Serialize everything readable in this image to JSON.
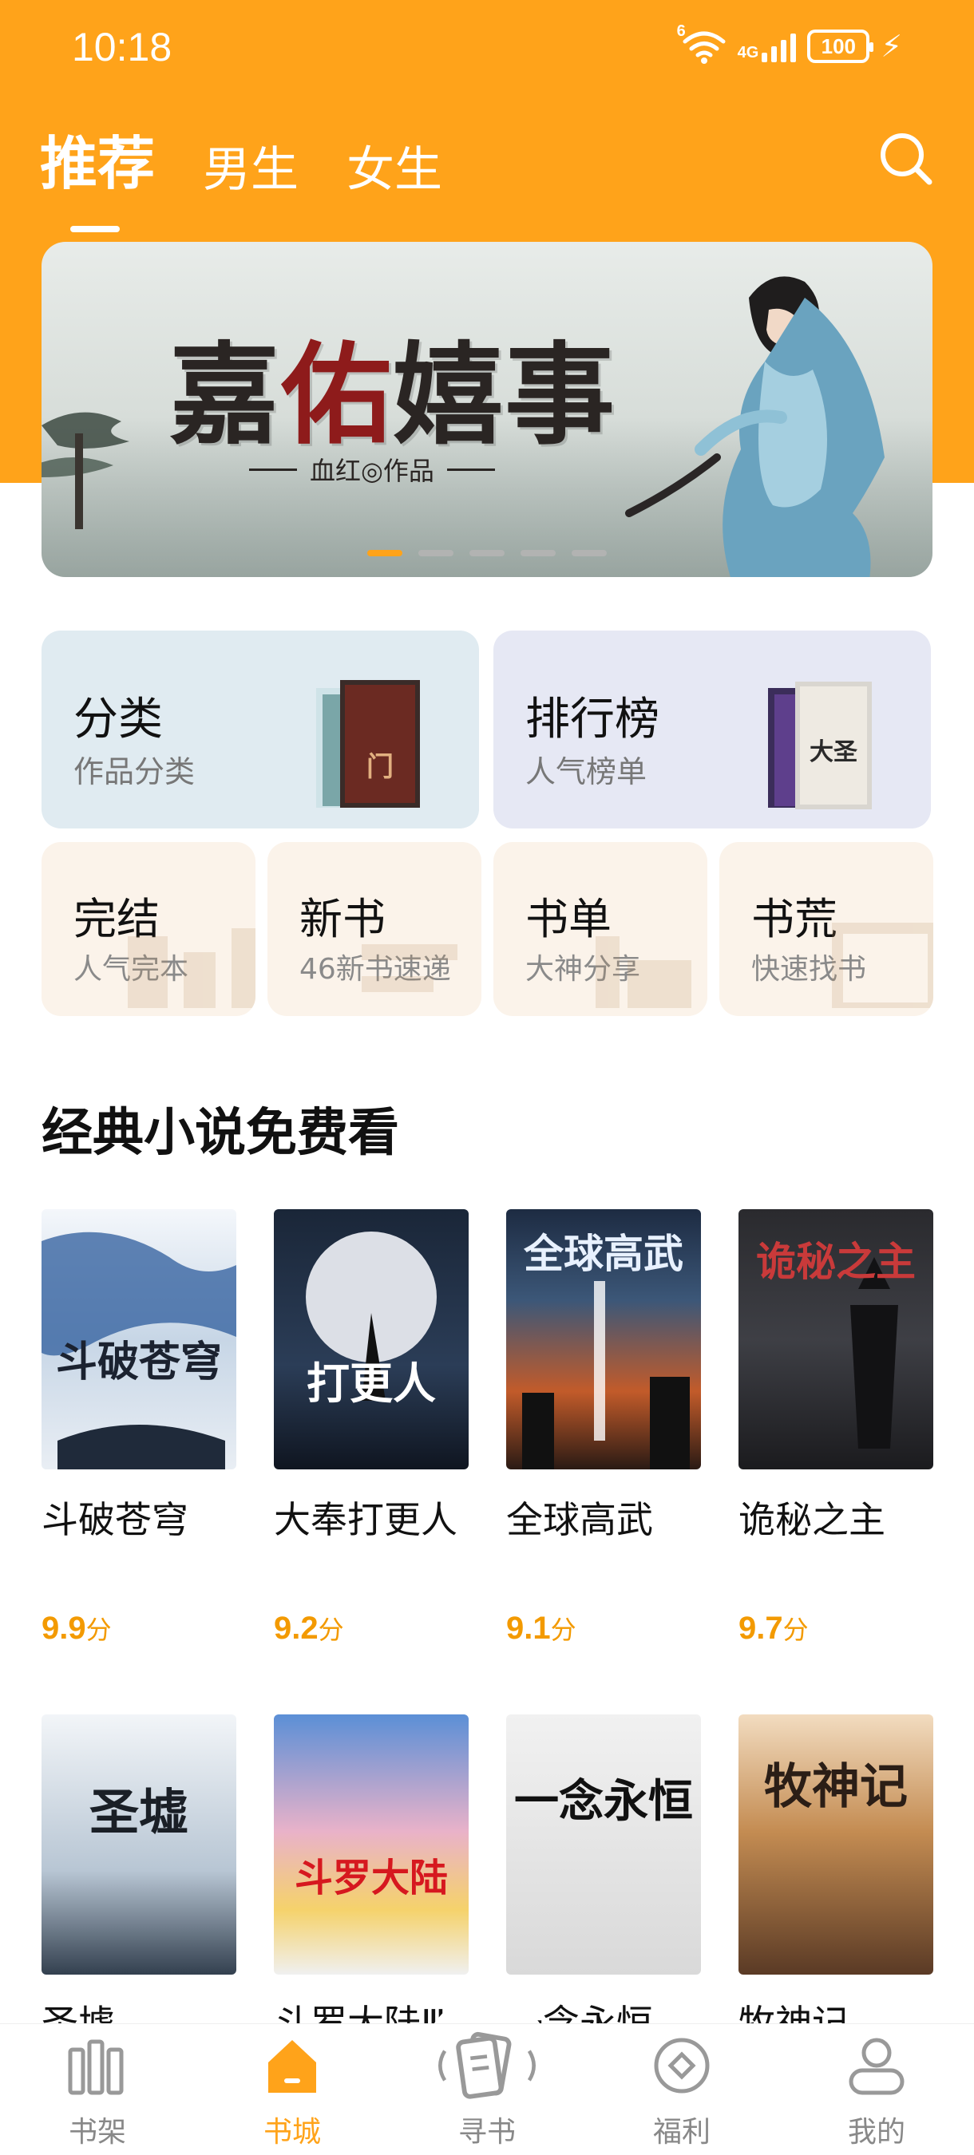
{
  "status_bar": {
    "time": "10:18",
    "wifi_tag": "6",
    "network": "4G",
    "battery": "100"
  },
  "top_tabs": [
    {
      "label": "推荐",
      "active": true
    },
    {
      "label": "男生",
      "active": false
    },
    {
      "label": "女生",
      "active": false
    }
  ],
  "banner": {
    "title_part1": "嘉",
    "title_part2": "佑",
    "title_part3": "嬉事",
    "subtitle": "血红◎作品",
    "page_count": 5,
    "active_index": 0
  },
  "entries_big": [
    {
      "title": "分类",
      "subtitle": "作品分类",
      "bg": "#e0ebf1"
    },
    {
      "title": "排行榜",
      "subtitle": "人气榜单",
      "bg": "#e6e8f4"
    }
  ],
  "entries_small": [
    {
      "title": "完结",
      "subtitle": "人气完本"
    },
    {
      "title": "新书",
      "subtitle": "46新书速递"
    },
    {
      "title": "书单",
      "subtitle": "大神分享"
    },
    {
      "title": "书荒",
      "subtitle": "快速找书"
    }
  ],
  "section": {
    "title": "经典小说免费看"
  },
  "books": [
    {
      "title": "斗破苍穹",
      "score": "9.9",
      "unit": "分",
      "cover_text": "斗破苍穹"
    },
    {
      "title": "大奉打更人",
      "score": "9.2",
      "unit": "分",
      "cover_text": "打更人"
    },
    {
      "title": "全球高武",
      "score": "9.1",
      "unit": "分",
      "cover_text": "全球高武"
    },
    {
      "title": "诡秘之主",
      "score": "9.7",
      "unit": "分",
      "cover_text": "诡秘之主"
    },
    {
      "title": "圣墟",
      "cover_text": "圣墟"
    },
    {
      "title": "斗罗大陆Ⅲ龙王传说",
      "cover_text": "斗罗大陆"
    },
    {
      "title": "一念永恒",
      "cover_text": "一念永恒"
    },
    {
      "title": "牧神记",
      "cover_text": "牧神记"
    }
  ],
  "bottom_nav": [
    {
      "label": "书架",
      "icon": "bookshelf-icon",
      "active": false
    },
    {
      "label": "书城",
      "icon": "bookstore-icon",
      "active": true
    },
    {
      "label": "寻书",
      "icon": "find-book-icon",
      "active": false
    },
    {
      "label": "福利",
      "icon": "coin-icon",
      "active": false
    },
    {
      "label": "我的",
      "icon": "profile-icon",
      "active": false
    }
  ],
  "colors": {
    "accent": "#ffa31a",
    "score": "#f39a00"
  }
}
